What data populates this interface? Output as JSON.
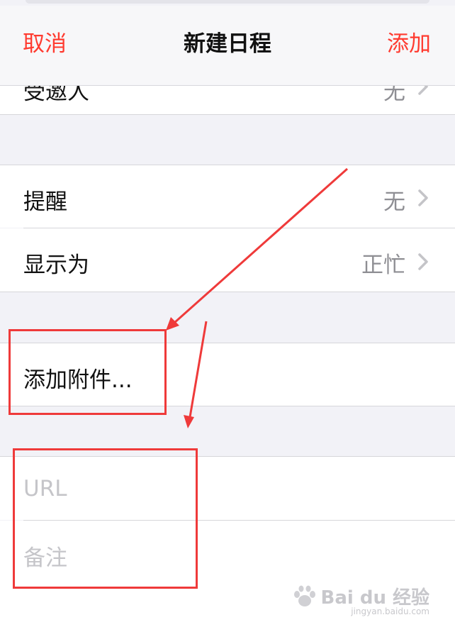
{
  "nav": {
    "cancel_label": "取消",
    "title": "新建日程",
    "add_label": "添加"
  },
  "rows": {
    "invitees": {
      "label": "受邀人",
      "value": "无"
    },
    "alert": {
      "label": "提醒",
      "value": "无"
    },
    "show_as": {
      "label": "显示为",
      "value": "正忙"
    },
    "attachment": {
      "label": "添加附件..."
    },
    "url": {
      "placeholder": "URL"
    },
    "notes": {
      "placeholder": "备注"
    }
  },
  "watermark": {
    "brand": "Bai du 经验",
    "url": "jingyan.baidu.com"
  },
  "colors": {
    "accent": "#ff3b30",
    "annotation": "#ef3a3a",
    "background": "#f2f2f7"
  }
}
